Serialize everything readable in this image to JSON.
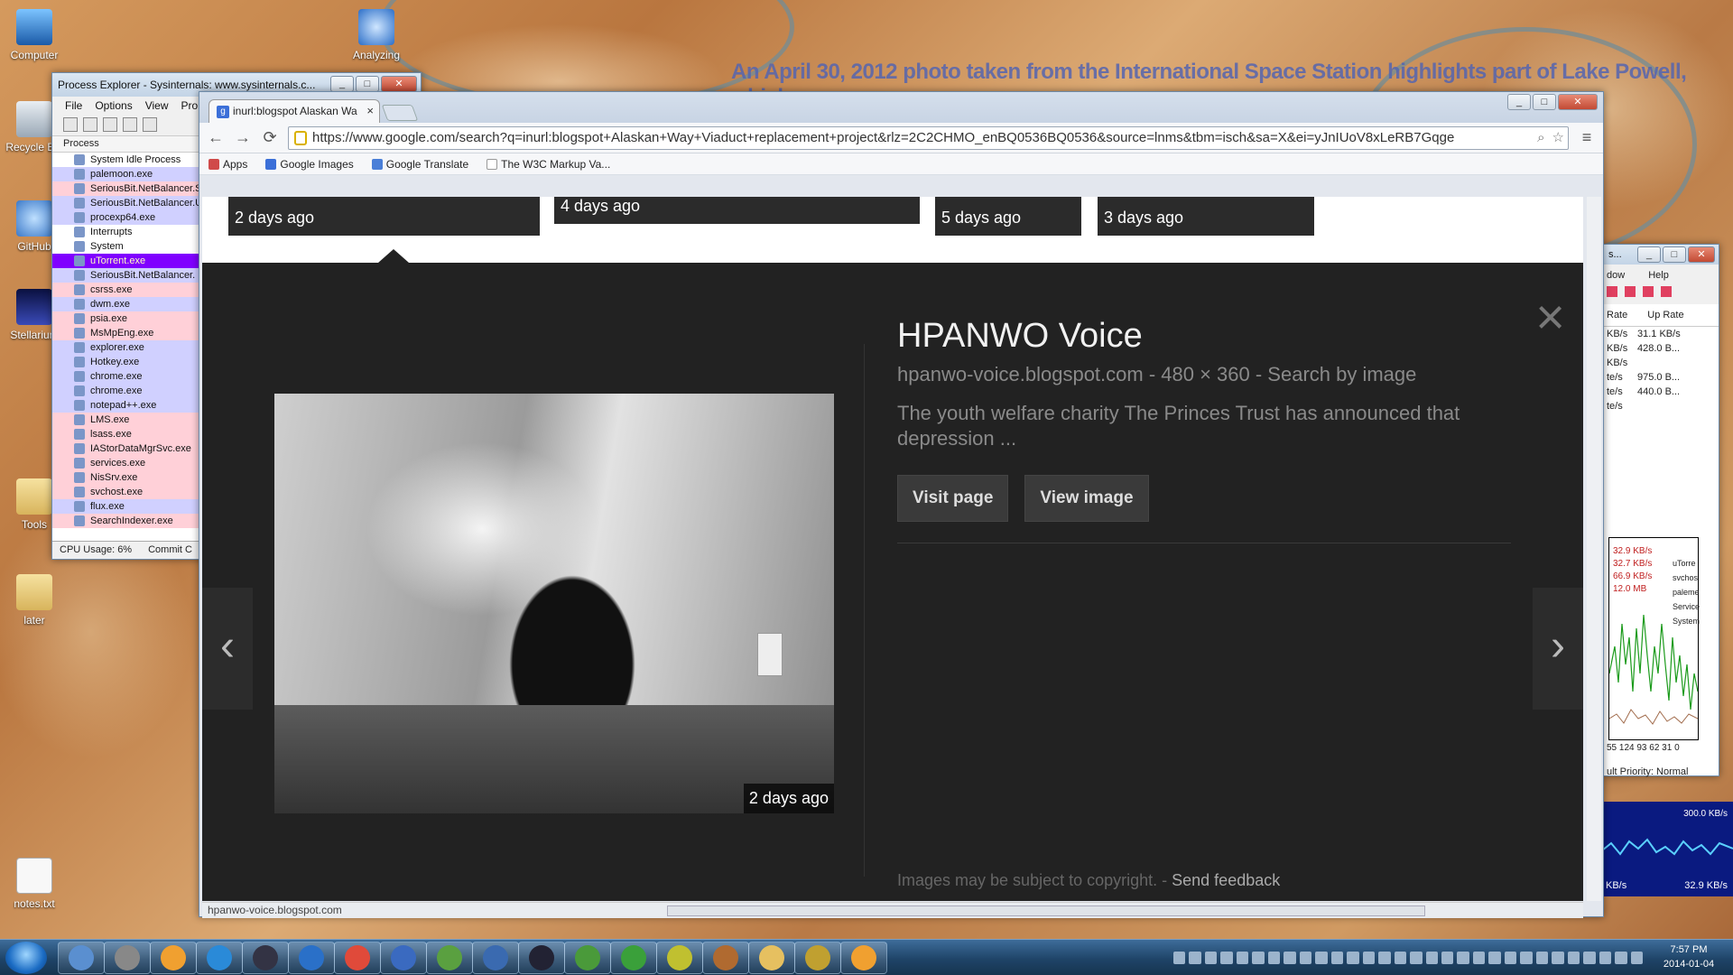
{
  "desktop": {
    "wallpaper_caption": "An April 30, 2012 photo taken from the International Space Station highlights part of Lake Powell, which",
    "icons": [
      {
        "label": "Computer",
        "icon": "computer-icon"
      },
      {
        "label": "Analyzing",
        "icon": "shortcut-icon"
      },
      {
        "label": "Recycle Bin",
        "icon": "recycle-bin-icon"
      },
      {
        "label": "GitHub",
        "icon": "github-icon"
      },
      {
        "label": "Stellarium",
        "icon": "stellarium-icon"
      },
      {
        "label": "Tools",
        "icon": "folder-icon"
      },
      {
        "label": "later",
        "icon": "folder-icon"
      },
      {
        "label": "notes.txt",
        "icon": "text-file-icon"
      }
    ]
  },
  "process_explorer": {
    "title": "Process Explorer - Sysinternals: www.sysinternals.c...",
    "menu": [
      "File",
      "Options",
      "View",
      "Pro"
    ],
    "column_header": "Process",
    "processes": [
      {
        "name": "System Idle Process",
        "style": "sel"
      },
      {
        "name": "palemoon.exe",
        "style": "blue"
      },
      {
        "name": "SeriousBit.NetBalancer.S",
        "style": "pink"
      },
      {
        "name": "SeriousBit.NetBalancer.U",
        "style": "blue"
      },
      {
        "name": "procexp64.exe",
        "style": "blue"
      },
      {
        "name": "Interrupts",
        "style": "sel"
      },
      {
        "name": "System",
        "style": "sel"
      },
      {
        "name": "uTorrent.exe",
        "style": "purple"
      },
      {
        "name": "SeriousBit.NetBalancer.",
        "style": "blue"
      },
      {
        "name": "csrss.exe",
        "style": "pink"
      },
      {
        "name": "dwm.exe",
        "style": "blue"
      },
      {
        "name": "psia.exe",
        "style": "pink"
      },
      {
        "name": "MsMpEng.exe",
        "style": "pink"
      },
      {
        "name": "explorer.exe",
        "style": "blue"
      },
      {
        "name": "Hotkey.exe",
        "style": "blue"
      },
      {
        "name": "chrome.exe",
        "style": "blue"
      },
      {
        "name": "chrome.exe",
        "style": "blue"
      },
      {
        "name": "notepad++.exe",
        "style": "blue"
      },
      {
        "name": "LMS.exe",
        "style": "pink"
      },
      {
        "name": "lsass.exe",
        "style": "pink"
      },
      {
        "name": "IAStorDataMgrSvc.exe",
        "style": "pink"
      },
      {
        "name": "services.exe",
        "style": "pink"
      },
      {
        "name": "NisSrv.exe",
        "style": "pink"
      },
      {
        "name": "svchost.exe",
        "style": "pink"
      },
      {
        "name": "flux.exe",
        "style": "blue"
      },
      {
        "name": "SearchIndexer.exe",
        "style": "pink"
      }
    ],
    "status": {
      "cpu": "CPU Usage: 6%",
      "commit": "Commit C"
    }
  },
  "netbalancer": {
    "title": "s...",
    "menu": [
      "dow",
      "Help"
    ],
    "headers": [
      "Rate",
      "Up Rate"
    ],
    "rows": [
      [
        "KB/s",
        "31.1 KB/s"
      ],
      [
        "KB/s",
        "428.0 B..."
      ],
      [
        "KB/s",
        ""
      ],
      [
        "te/s",
        "975.0 B..."
      ],
      [
        "te/s",
        "440.0 B..."
      ],
      [
        "te/s",
        ""
      ]
    ],
    "graph_labels": [
      "32.9 KB/s",
      "32.7 KB/s",
      "66.9 KB/s",
      "12.0 MB"
    ],
    "legend": [
      "uTorre",
      "svchos",
      "paleme",
      "Service",
      "System"
    ],
    "axis": "55 124 93 62 31 0",
    "priority": "ult Priority: Normal",
    "bandwidth": {
      "top": "300.0 KB/s",
      "left": "KB/s",
      "right": "32.9 KB/s"
    }
  },
  "chrome": {
    "tab_title": "inurl:blogspot Alaskan Wa",
    "tab_favicon": "google-favicon",
    "url": "https://www.google.com/search?q=inurl:blogspot+Alaskan+Way+Viaduct+replacement+project&rlz=2C2CHMO_enBQ0536BQ0536&source=lnms&tbm=isch&sa=X&ei=yJnIUoV8xLeRB7Gqge",
    "bookmarks": [
      {
        "label": "Apps",
        "icon": "apps-grid-icon",
        "color": "#d04a4a"
      },
      {
        "label": "Google Images",
        "icon": "google-favicon",
        "color": "#3b6fd8"
      },
      {
        "label": "Google Translate",
        "icon": "translate-icon",
        "color": "#4a7fd8"
      },
      {
        "label": "The W3C Markup Va...",
        "icon": "page-icon",
        "color": "#dddddd"
      }
    ],
    "status_url": "hpanwo-voice.blogspot.com"
  },
  "results_strip": [
    {
      "caption": "2 days ago"
    },
    {
      "caption": "4 days ago"
    },
    {
      "caption": "5 days ago"
    },
    {
      "caption": "3 days ago"
    }
  ],
  "preview": {
    "title": "HPANWO Voice",
    "meta": "hpanwo-voice.blogspot.com - 480 × 360 - Search by image",
    "description": "The youth welfare charity The Princes Trust has announced that depression ...",
    "image_caption": "2 days ago",
    "visit_label": "Visit page",
    "view_label": "View image",
    "copyright": "Images may be subject to copyright.",
    "separator": " - ",
    "feedback": "Send feedback",
    "prev_glyph": "‹",
    "next_glyph": "›",
    "close_glyph": "×"
  },
  "taskbar": {
    "items": [
      "explorer-icon",
      "camera-icon",
      "windows-icon",
      "globe-icon",
      "lock-icon",
      "palemoon-icon",
      "chrome-icon",
      "thunderbird-icon",
      "notepad-icon",
      "procexp-icon",
      "monitor-icon",
      "python-icon",
      "utorrent-icon",
      "search-file-icon",
      "game-icon",
      "folder-icon",
      "keys-icon",
      "windows-update-icon"
    ],
    "time": "7:57 PM",
    "date": "2014-01-04"
  },
  "colors": {
    "accent": "#3b6fd8",
    "preview_bg": "#222222",
    "process_purple": "#8000ff"
  }
}
